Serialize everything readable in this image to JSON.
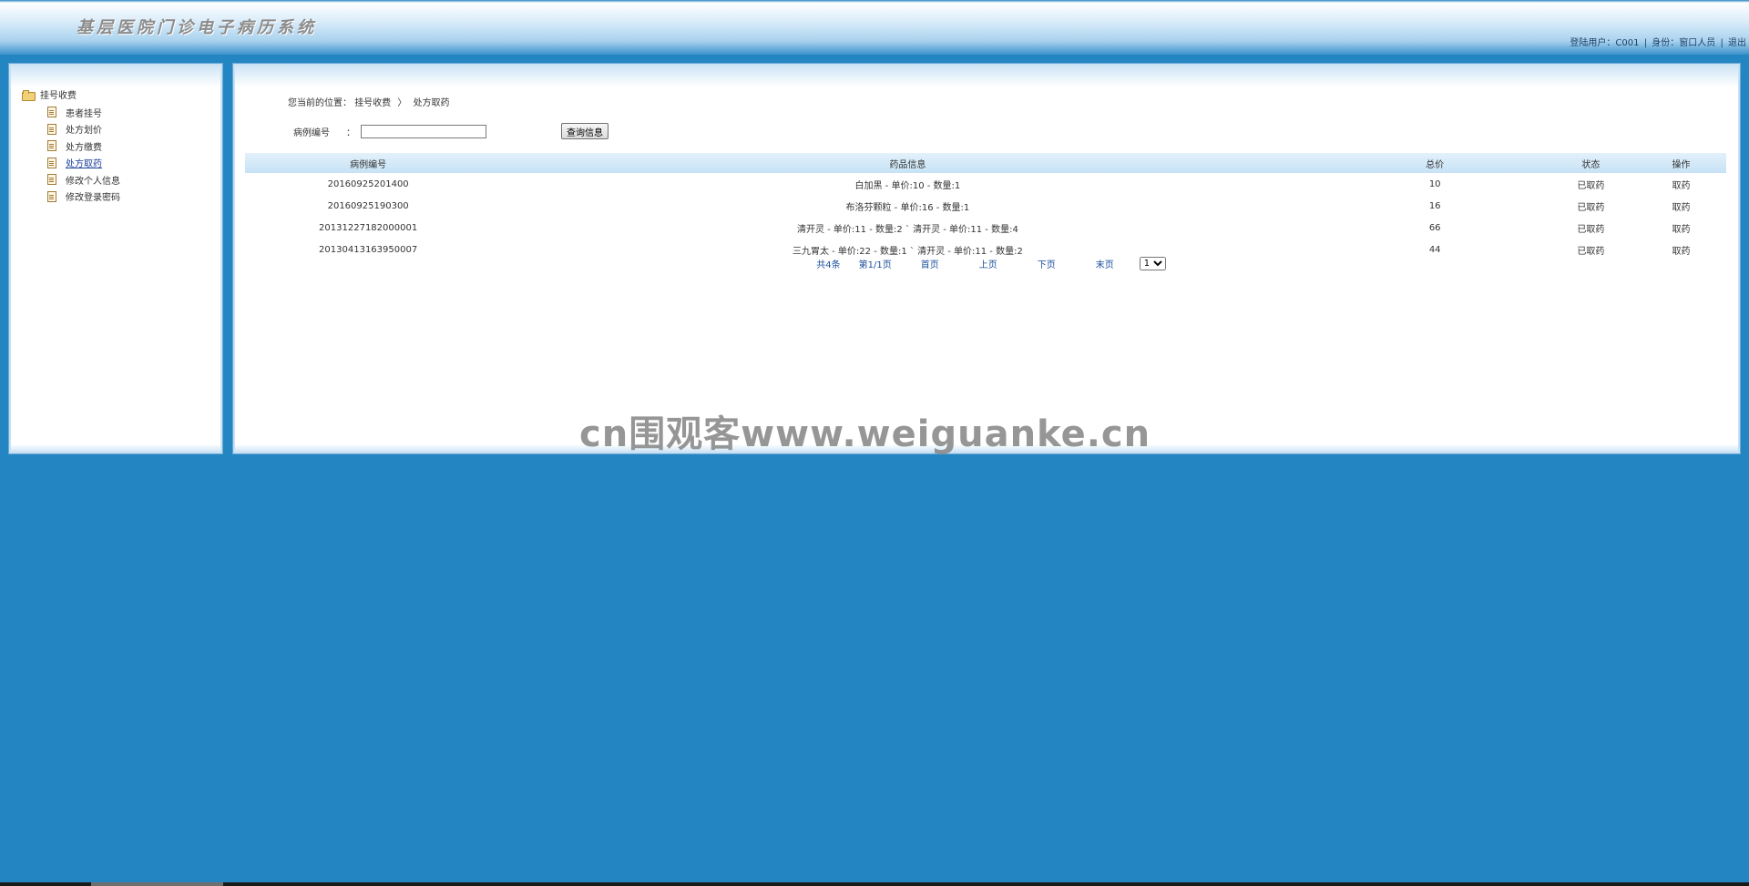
{
  "header": {
    "title": "基层医院门诊电子病历系统",
    "user_label": "登陆用户：C001",
    "sep": "|",
    "role_label": "身份：窗口人员",
    "logout": "退出"
  },
  "sidebar": {
    "root": "挂号收费",
    "items": [
      {
        "label": "患者挂号"
      },
      {
        "label": "处方划价"
      },
      {
        "label": "处方缴费"
      },
      {
        "label": "处方取药"
      },
      {
        "label": "修改个人信息"
      },
      {
        "label": "修改登录密码"
      }
    ]
  },
  "breadcrumb": {
    "prefix": "您当前的位置：",
    "level1": "挂号收费",
    "sep": "〉",
    "level2": "处方取药"
  },
  "search": {
    "label": "病例编号",
    "colon": "：",
    "value": "",
    "button": "查询信息"
  },
  "table": {
    "headers": [
      "病例编号",
      "药品信息",
      "总价",
      "状态",
      "操作"
    ],
    "rows": [
      [
        "20160925201400",
        "白加黑 - 单价:10 - 数量:1",
        "10",
        "已取药",
        "取药"
      ],
      [
        "20160925190300",
        "布洛芬颗粒 - 单价:16 - 数量:1",
        "16",
        "已取药",
        "取药"
      ],
      [
        "20131227182000001",
        "清开灵 - 单价:11 - 数量:2 ` 清开灵 - 单价:11 - 数量:4",
        "66",
        "已取药",
        "取药"
      ],
      [
        "20130413163950007",
        "三九胃太 - 单价:22 - 数量:1 ` 清开灵 - 单价:11 - 数量:2",
        "44",
        "已取药",
        "取药"
      ]
    ]
  },
  "pager": {
    "total": "共4条",
    "page_info": "第1/1页",
    "first": "首页",
    "prev": "上页",
    "next": "下页",
    "last": "末页",
    "selected": "1"
  },
  "watermark": "cn围观客www.weiguanke.cn"
}
